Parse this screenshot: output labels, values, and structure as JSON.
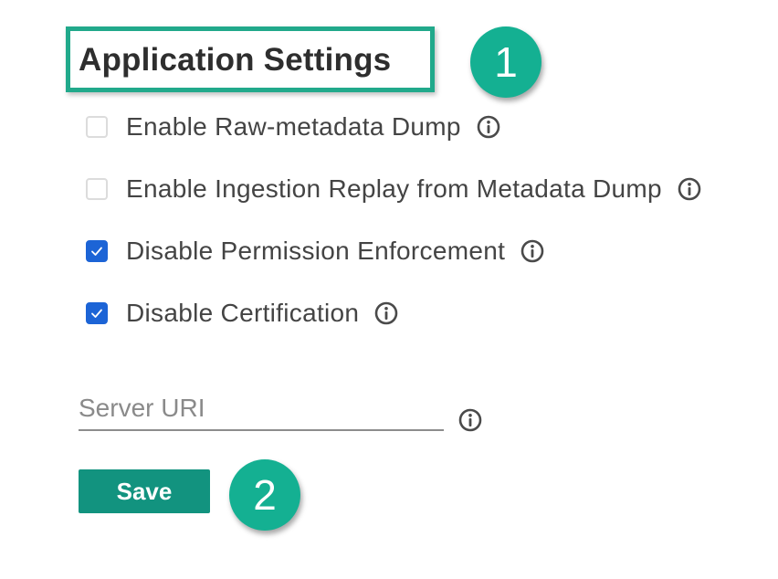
{
  "settings": {
    "title": "Application Settings",
    "options": [
      {
        "label": "Enable Raw-metadata Dump",
        "checked": false
      },
      {
        "label": "Enable Ingestion Replay from Metadata Dump",
        "checked": false
      },
      {
        "label": "Disable Permission Enforcement",
        "checked": true
      },
      {
        "label": "Disable Certification",
        "checked": true
      }
    ],
    "server_uri": {
      "value": "",
      "placeholder": "Server URI"
    },
    "save_label": "Save"
  },
  "callouts": {
    "step_1": "1",
    "step_2": "2"
  },
  "colors": {
    "accent": "#21a98b",
    "badge": "#14b092",
    "save_button": "#12937f",
    "checkbox_checked": "#1c64d6"
  },
  "icons": {
    "info": "info-circle-icon",
    "check": "checkmark-icon"
  }
}
